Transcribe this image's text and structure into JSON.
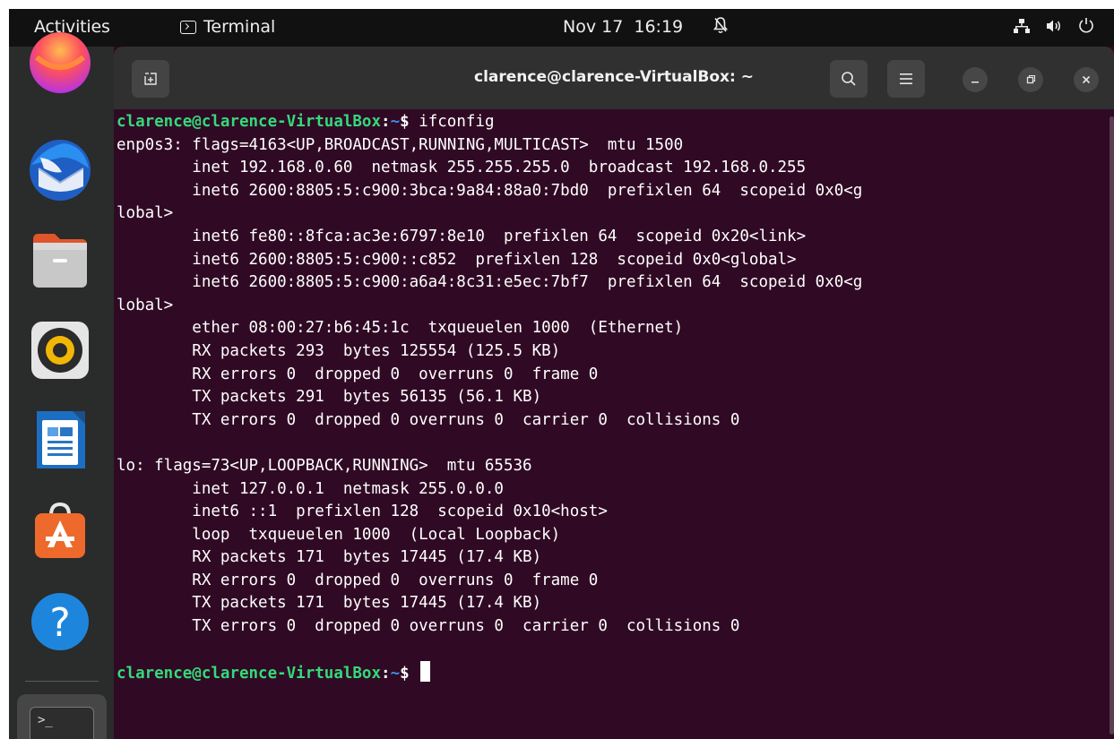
{
  "topbar": {
    "activities": "Activities",
    "app_name": "Terminal",
    "clock": "Nov 17  16:19"
  },
  "dock": {
    "items": [
      {
        "name": "Firefox Web Browser",
        "icon": "firefox-icon"
      },
      {
        "name": "Thunderbird Mail",
        "icon": "thunderbird-icon"
      },
      {
        "name": "Files",
        "icon": "files-icon"
      },
      {
        "name": "Rhythmbox",
        "icon": "rhythmbox-icon"
      },
      {
        "name": "LibreOffice Writer",
        "icon": "writer-icon"
      },
      {
        "name": "Ubuntu Software",
        "icon": "software-icon"
      },
      {
        "name": "Help",
        "icon": "help-icon",
        "glyph": "?"
      },
      {
        "name": "Terminal",
        "icon": "terminal-icon",
        "glyph": ">_"
      }
    ]
  },
  "window": {
    "title": "clarence@clarence-VirtualBox: ~",
    "buttons": {
      "new_tab": "new-tab-icon",
      "search": "search-icon",
      "menu": "hamburger-icon",
      "minimize": "minimize-icon",
      "maximize": "maximize-icon",
      "close": "close-icon"
    }
  },
  "terminal": {
    "prompt": {
      "user_host": "clarence@clarence-VirtualBox",
      "colon": ":",
      "path": "~",
      "dollar": "$ "
    },
    "command": "ifconfig",
    "output": [
      "enp0s3: flags=4163<UP,BROADCAST,RUNNING,MULTICAST>  mtu 1500",
      "        inet 192.168.0.60  netmask 255.255.255.0  broadcast 192.168.0.255",
      "        inet6 2600:8805:5:c900:3bca:9a84:88a0:7bd0  prefixlen 64  scopeid 0x0<g",
      "lobal>",
      "        inet6 fe80::8fca:ac3e:6797:8e10  prefixlen 64  scopeid 0x20<link>",
      "        inet6 2600:8805:5:c900::c852  prefixlen 128  scopeid 0x0<global>",
      "        inet6 2600:8805:5:c900:a6a4:8c31:e5ec:7bf7  prefixlen 64  scopeid 0x0<g",
      "lobal>",
      "        ether 08:00:27:b6:45:1c  txqueuelen 1000  (Ethernet)",
      "        RX packets 293  bytes 125554 (125.5 KB)",
      "        RX errors 0  dropped 0  overruns 0  frame 0",
      "        TX packets 291  bytes 56135 (56.1 KB)",
      "        TX errors 0  dropped 0 overruns 0  carrier 0  collisions 0",
      "",
      "lo: flags=73<UP,LOOPBACK,RUNNING>  mtu 65536",
      "        inet 127.0.0.1  netmask 255.0.0.0",
      "        inet6 ::1  prefixlen 128  scopeid 0x10<host>",
      "        loop  txqueuelen 1000  (Local Loopback)",
      "        RX packets 171  bytes 17445 (17.4 KB)",
      "        RX errors 0  dropped 0  overruns 0  frame 0",
      "        TX packets 171  bytes 17445 (17.4 KB)",
      "        TX errors 0  dropped 0 overruns 0  carrier 0  collisions 0",
      ""
    ]
  },
  "colors": {
    "terminal_bg": "#300a24",
    "prompt_user": "#33da7a",
    "prompt_path": "#3a8ee6",
    "topbar_bg": "#111111",
    "dock_bg": "#2a2b2b",
    "headerbar_bg": "#303030"
  }
}
